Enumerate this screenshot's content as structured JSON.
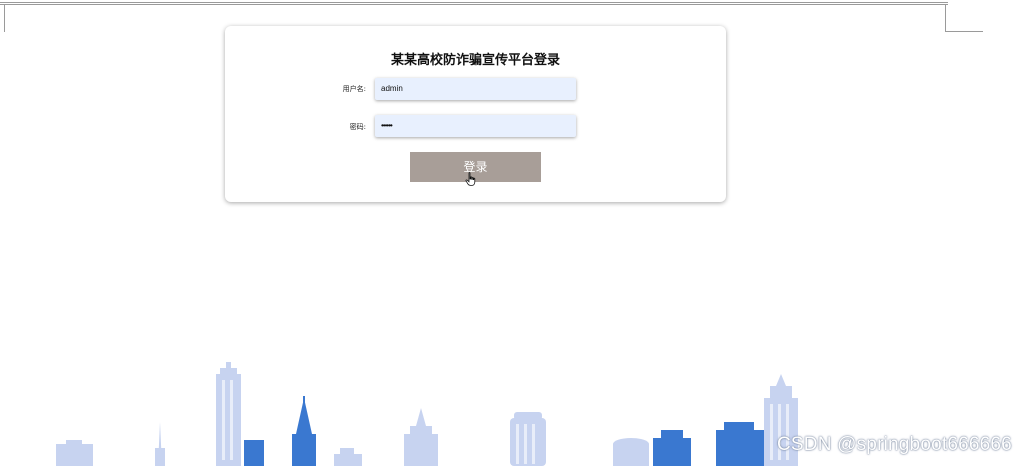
{
  "login": {
    "title": "某某高校防诈骗宣传平台登录",
    "username_label": "用户名:",
    "username_value": "admin",
    "password_label": "密码:",
    "password_value": "••••••",
    "submit_label": "登录"
  },
  "watermark": {
    "text": "CSDN @springboot666666"
  },
  "colors": {
    "input_bg": "#e8f0fe",
    "button_bg": "#a89e98",
    "skyline_light": "#c7d3f0",
    "skyline_dark": "#3a78d0"
  },
  "icons": {
    "cursor": "hand-pointer-icon",
    "background": "city-skyline"
  }
}
